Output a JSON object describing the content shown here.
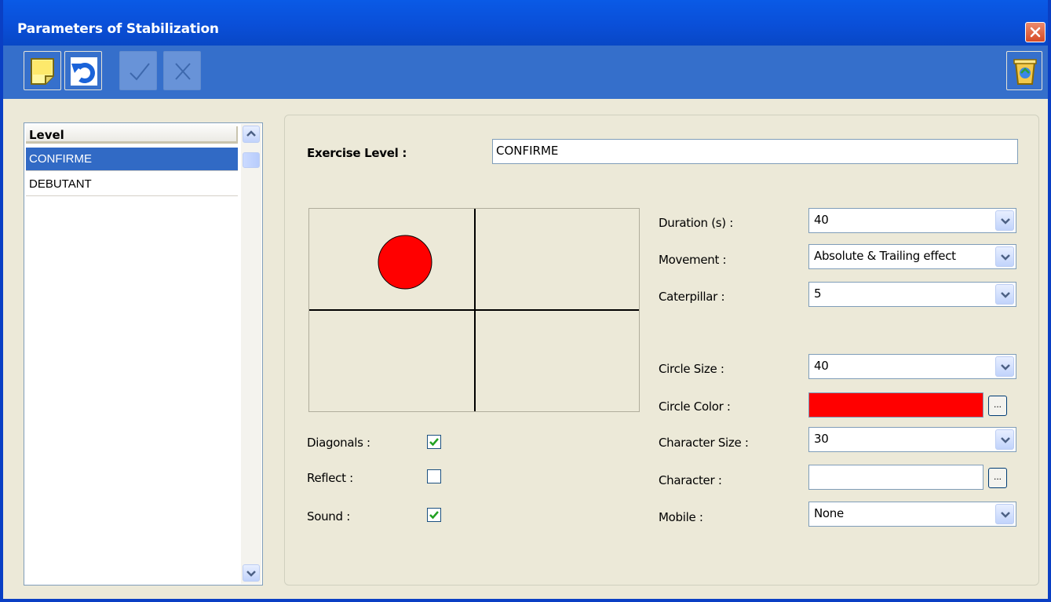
{
  "window": {
    "title": "Parameters of Stabilization"
  },
  "toolbar": {
    "buttons": [
      {
        "name": "new",
        "icon": "note-icon",
        "enabled": true
      },
      {
        "name": "undo",
        "icon": "undo-icon",
        "enabled": true
      },
      {
        "name": "validate",
        "icon": "check-icon",
        "enabled": false
      },
      {
        "name": "cancel",
        "icon": "cross-icon",
        "enabled": false
      },
      {
        "name": "delete",
        "icon": "recycle-bin-icon",
        "enabled": true
      }
    ]
  },
  "level_list": {
    "header": "Level",
    "items": [
      "CONFIRME",
      "DEBUTANT"
    ],
    "selected": "CONFIRME"
  },
  "form": {
    "exercise_level_label": "Exercise Level :",
    "exercise_level_value": "CONFIRME",
    "diagonals_label": "Diagonals :",
    "diagonals_checked": true,
    "reflect_label": "Reflect :",
    "reflect_checked": false,
    "sound_label": "Sound :",
    "sound_checked": true,
    "duration_label": "Duration (s) :",
    "duration_value": "40",
    "movement_label": "Movement :",
    "movement_value": "Absolute & Trailing effect",
    "caterpillar_label": "Caterpillar :",
    "caterpillar_value": "5",
    "circle_size_label": "Circle Size :",
    "circle_size_value": "40",
    "circle_color_label": "Circle Color :",
    "circle_color_value": "#ff0000",
    "character_size_label": "Character Size :",
    "character_size_value": "30",
    "character_label": "Character :",
    "character_value": "",
    "mobile_label": "Mobile :",
    "mobile_value": "None",
    "ellipsis_label": "..."
  },
  "colors": {
    "titlebar": "#0a4fd8",
    "toolbar": "#356fcb",
    "selection": "#316ac5",
    "circle": "#ff0000",
    "window_bg": "#ece9d8"
  }
}
